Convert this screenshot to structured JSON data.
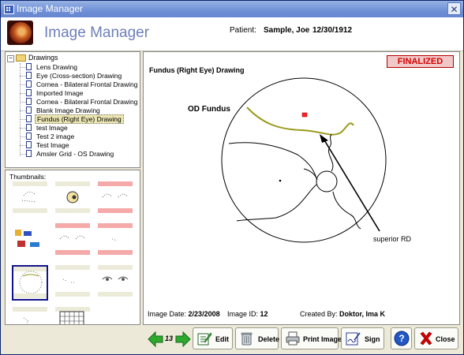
{
  "window": {
    "title": "Image Manager",
    "close_glyph": "✕"
  },
  "header": {
    "app_title": "Image Manager",
    "patient_label": "Patient:",
    "patient_name": "Sample, Joe",
    "patient_dob": "12/30/1912"
  },
  "tree": {
    "root_label": "Drawings",
    "expand_glyph": "−",
    "items": [
      {
        "label": "Lens Drawing"
      },
      {
        "label": "Eye (Cross-section) Drawing"
      },
      {
        "label": "Cornea - Bilateral Frontal Drawing"
      },
      {
        "label": "Imported Image"
      },
      {
        "label": "Cornea - Bilateral Frontal Drawing"
      },
      {
        "label": "Blank Image Drawing"
      },
      {
        "label": "Fundus (Right Eye) Drawing",
        "selected": true
      },
      {
        "label": "test Image"
      },
      {
        "label": "Test 2 image"
      },
      {
        "label": "Test Image"
      },
      {
        "label": "Amsler Grid - OS Drawing"
      }
    ]
  },
  "thumbnails": {
    "label": "Thumbnails:"
  },
  "viewer": {
    "status_badge": "FINALIZED",
    "drawing_title": "Fundus (Right Eye) Drawing",
    "drawing_label": "OD Fundus",
    "annotation": "superior RD",
    "image_date_label": "Image Date:",
    "image_date": "2/23/2008",
    "image_id_label": "Image ID:",
    "image_id": "12",
    "created_by_label": "Created By:",
    "created_by": "Doktor, Ima K"
  },
  "toolbar": {
    "page_number": "13",
    "edit_label": "Edit",
    "delete_label": "Delete",
    "print_label": "Print Image",
    "sign_label": "Sign",
    "close_label": "Close",
    "help_glyph": "?"
  },
  "colors": {
    "title_bar": "#6f90d6",
    "app_title": "#6e7fb9",
    "finalized_text": "#d40000",
    "detachment_line": "#9a9a1e",
    "thumb_band_pink": "#f5a9a9",
    "arrow_green": "#2fa82f",
    "close_x_red": "#d40000"
  }
}
